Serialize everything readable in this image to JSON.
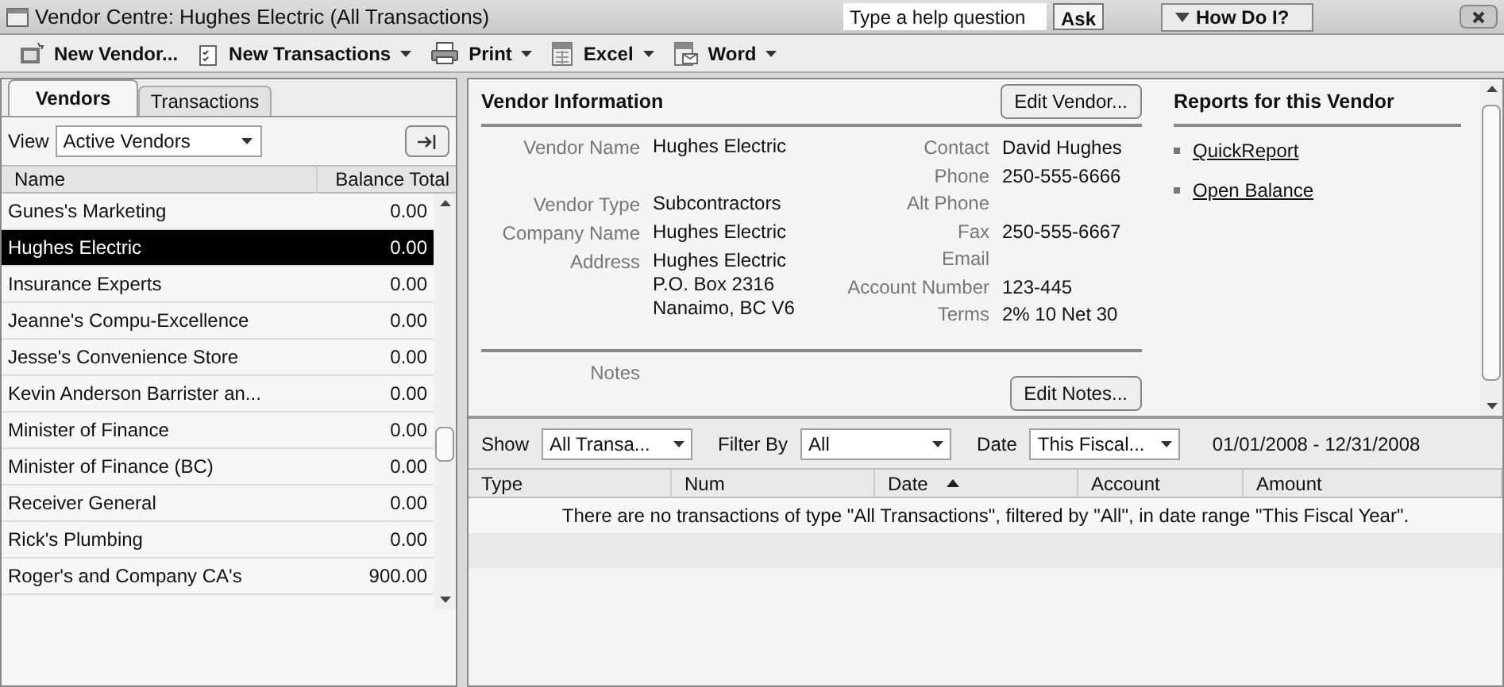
{
  "window": {
    "title": "Vendor Centre: Hughes Electric (All Transactions)",
    "help_field": {
      "placeholder": "Type a help question"
    },
    "ask_button": "Ask",
    "how_do_i_button": "How Do I?"
  },
  "toolbar": [
    {
      "kind": "vendor",
      "label": "New Vendor...",
      "has_menu": false
    },
    {
      "kind": "transactions",
      "label": "New Transactions",
      "has_menu": true
    },
    {
      "kind": "print",
      "label": "Print",
      "has_menu": true
    },
    {
      "kind": "excel",
      "label": "Excel",
      "has_menu": true
    },
    {
      "kind": "word",
      "label": "Word",
      "has_menu": true
    }
  ],
  "tabs": [
    {
      "label": "Vendors",
      "selected": true
    },
    {
      "label": "Transactions",
      "selected": false
    }
  ],
  "view": {
    "label": "View",
    "value": "Active Vendors"
  },
  "vendor_table": {
    "columns": [
      "Name",
      "Balance Total"
    ],
    "rows": [
      {
        "name": "Gunes's Marketing",
        "balance": "0.00",
        "selected": false
      },
      {
        "name": "Hughes Electric",
        "balance": "0.00",
        "selected": true
      },
      {
        "name": "Insurance Experts",
        "balance": "0.00",
        "selected": false
      },
      {
        "name": "Jeanne's Compu-Excellence",
        "balance": "0.00",
        "selected": false
      },
      {
        "name": "Jesse's Convenience Store",
        "balance": "0.00",
        "selected": false
      },
      {
        "name": "Kevin Anderson Barrister an...",
        "balance": "0.00",
        "selected": false
      },
      {
        "name": "Minister of Finance",
        "balance": "0.00",
        "selected": false
      },
      {
        "name": "Minister of Finance (BC)",
        "balance": "0.00",
        "selected": false
      },
      {
        "name": "Receiver General",
        "balance": "0.00",
        "selected": false
      },
      {
        "name": "Rick's Plumbing",
        "balance": "0.00",
        "selected": false
      },
      {
        "name": "Roger's and Company CA's",
        "balance": "900.00",
        "selected": false
      }
    ]
  },
  "vendor_info": {
    "heading": "Vendor Information",
    "edit_button": "Edit Vendor...",
    "left_fields": [
      {
        "label": "Vendor Name",
        "value": "Hughes Electric"
      },
      {
        "label": "Vendor Type",
        "value": "Subcontractors"
      },
      {
        "label": "Company Name",
        "value": "Hughes Electric"
      },
      {
        "label": "Address",
        "value": "Hughes Electric\nP.O. Box 2316\nNanaimo, BC V6"
      }
    ],
    "right_fields": [
      {
        "label": "Contact",
        "value": "David Hughes"
      },
      {
        "label": "Phone",
        "value": "250-555-6666"
      },
      {
        "label": "Alt Phone"
      },
      {
        "label": "Fax",
        "value": "250-555-6667"
      },
      {
        "label": "Email"
      },
      {
        "label": "Account Number",
        "value": "123-445"
      },
      {
        "label": "Terms",
        "value": "2% 10 Net 30"
      }
    ],
    "notes_label": "Notes",
    "edit_notes_button": "Edit Notes..."
  },
  "reports": {
    "heading": "Reports for this Vendor",
    "links": [
      "QuickReport",
      "Open Balance"
    ]
  },
  "filters": {
    "show": {
      "label": "Show",
      "value": "All Transa..."
    },
    "filter_by": {
      "label": "Filter By",
      "value": "All"
    },
    "date": {
      "label": "Date",
      "value": "This Fiscal..."
    },
    "date_range": "01/01/2008 - 12/31/2008"
  },
  "transactions_table": {
    "columns": [
      {
        "label": "Type",
        "sorted": false
      },
      {
        "label": "Num",
        "sorted": false
      },
      {
        "label": "Date",
        "sorted": true
      },
      {
        "label": "Account",
        "sorted": false
      },
      {
        "label": "Amount",
        "sorted": false
      }
    ],
    "message": "There are no transactions of type \"All Transactions\", filtered by \"All\", in date range \"This Fiscal Year\"."
  }
}
